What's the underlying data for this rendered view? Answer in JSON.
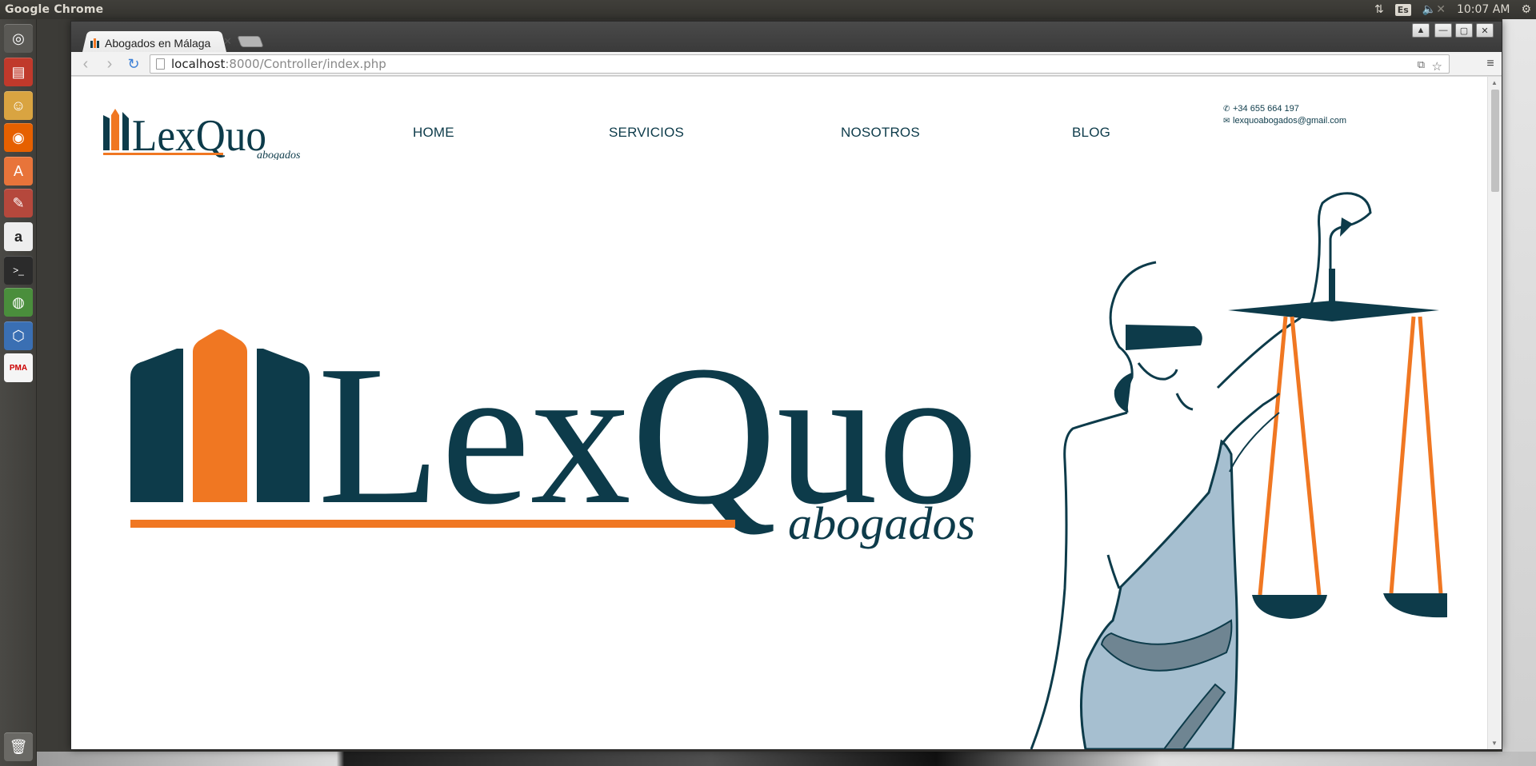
{
  "desktop": {
    "app_title": "Google Chrome",
    "keyboard_layout": "Es",
    "clock": "10:07 AM"
  },
  "browser": {
    "tab_title": "Abogados en Málaga",
    "url_host": "localhost",
    "url_path": ":8000/Controller/index.php"
  },
  "site": {
    "logo_text": "LexQuo",
    "logo_subtext": "abogados",
    "nav": {
      "home": "HOME",
      "servicios": "SERVICIOS",
      "nosotros": "NOSOTROS",
      "blog": "BLOG"
    },
    "contact": {
      "phone": "+34 655 664 197",
      "email": "lexquoabogados@gmail.com"
    },
    "colors": {
      "brand_dark": "#0d3b4a",
      "brand_orange": "#f07722",
      "robe_blue": "#a6bfd0"
    }
  }
}
